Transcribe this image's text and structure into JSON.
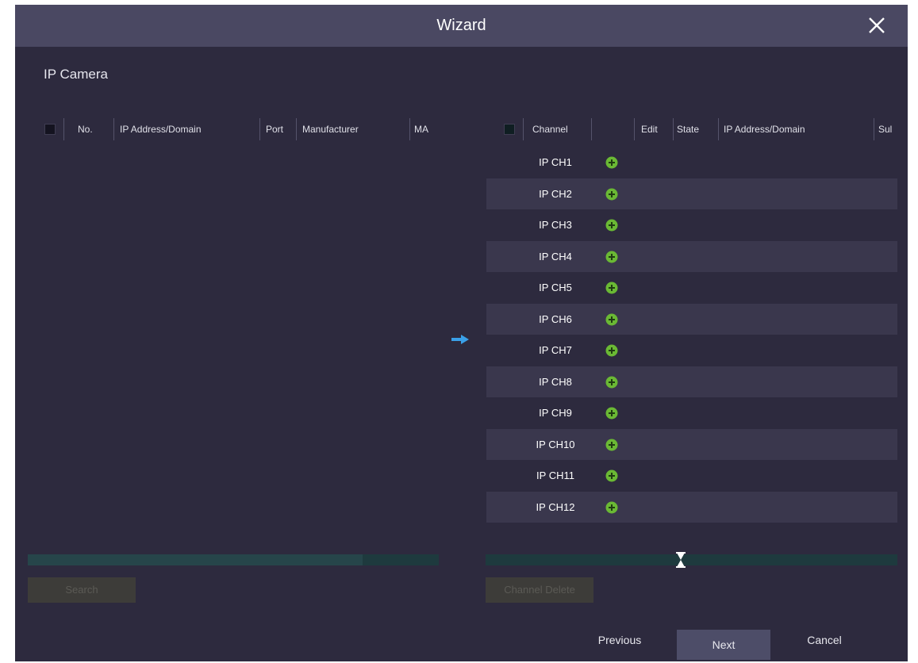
{
  "window": {
    "title": "Wizard"
  },
  "section": {
    "label": "IP Camera"
  },
  "left_table": {
    "columns": [
      "No.",
      "IP Address/Domain",
      "Port",
      "Manufacturer",
      "MA"
    ],
    "search_button": "Search"
  },
  "right_table": {
    "columns": [
      "Channel",
      "Edit",
      "State",
      "IP Address/Domain",
      "Sul"
    ],
    "rows": [
      "IP CH1",
      "IP CH2",
      "IP CH3",
      "IP CH4",
      "IP CH5",
      "IP CH6",
      "IP CH7",
      "IP CH8",
      "IP CH9",
      "IP CH10",
      "IP CH11",
      "IP CH12"
    ],
    "delete_button": "Channel Delete"
  },
  "footer": {
    "previous": "Previous",
    "next": "Next",
    "cancel": "Cancel"
  },
  "colors": {
    "window_bg": "#2d2a3e",
    "titlebar_bg": "#4a4862",
    "alt_row": "#3a374d",
    "add_icon": "#6ab934",
    "arrow_icon": "#3aa0e8"
  }
}
